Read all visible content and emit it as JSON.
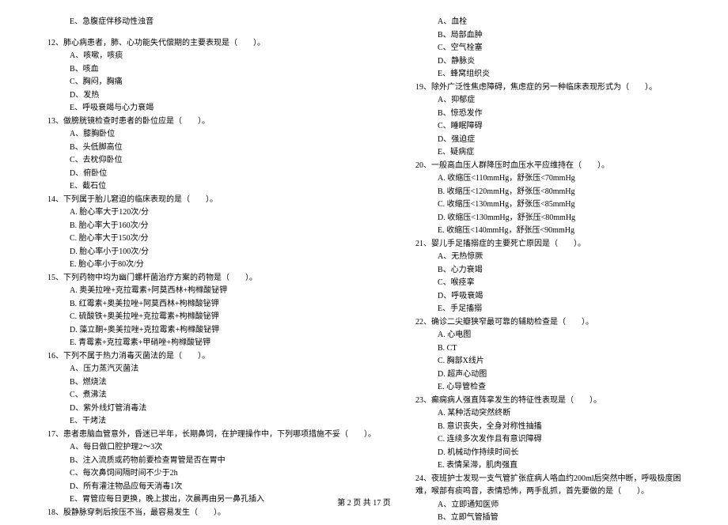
{
  "left": {
    "q11e": "E、急腹症伴移动性浊音",
    "q12": "12、肺心病患者，肺、心功能失代偿期的主要表现是（　　）。",
    "q12a": "A、咳嗽，咳痰",
    "q12b": "B、咳血",
    "q12c": "C、胸闷，胸痛",
    "q12d": "D、发热",
    "q12e": "E、呼吸衰竭与心力衰竭",
    "q13": "13、做膀胱镜检查时患者的卧位应是（　　）。",
    "q13a": "A、膝胸卧位",
    "q13b": "B、头低脚高位",
    "q13c": "C、去枕仰卧位",
    "q13d": "D、俯卧位",
    "q13e": "E、截石位",
    "q14": "14、下列属于胎儿窘迫的临床表现的是（　　）。",
    "q14a": "A. 胎心率大于120次/分",
    "q14b": "B. 胎心率大于160次/分",
    "q14c": "C. 胎心率大于150次/分",
    "q14d": "D. 胎心率小于100次/分",
    "q14e": "E. 胎心率小于80次/分",
    "q15": "15、下列药物中均为幽门螺杆菌治疗方案的药物是（　　）。",
    "q15a": "A. 奥美拉唑+克拉霉素+阿莫西林+枸橼酸铋钾",
    "q15b": "B. 红霉素+奥美拉唑+阿莫西林+枸橼酸铋钾",
    "q15c": "C. 硫酸铁+奥美拉唑+克拉霉素+枸橼酸铋钾",
    "q15d": "D. 藻立酮+奥美拉唑+克拉霉素+枸橼酸铋钾",
    "q15e": "E. 青霉素+克拉霉素+甲硝唑+枸橼酸铋钾",
    "q16": "16、下列不属于热力消毒灭菌法的是（　　）。",
    "q16a": "A、压力蒸汽灭菌法",
    "q16b": "B、燃烧法",
    "q16c": "C、煮沸法",
    "q16d": "D、紫外线灯管消毒法",
    "q16e": "E、干烤法",
    "q17": "17、患者患脑血管意外，昏迷已半年，长期鼻饲，在护理操作中，下列哪项措施不妥（　　）。",
    "q17a": "A、每日做口腔护理2～3次",
    "q17b": "B、注入流质或药物前要检查胃管是否在胃中",
    "q17c": "C、每次鼻饲间隔时间不少于2h",
    "q17d": "D、所有灌注物品应每天消毒1次",
    "q17e": "E、胃管应每日更换，晚上拔出，次晨再由另一鼻孔插入",
    "q18": "18、股静脉穿刺后按压不当，最容易发生（　　）。"
  },
  "right": {
    "q18a": "A、血栓",
    "q18b": "B、局部血肿",
    "q18c": "C、空气栓塞",
    "q18d": "D、静脉炎",
    "q18e": "E、蜂窝组织炎",
    "q19": "19、除外广泛性焦虑障碍，焦虑症的另一种临床表现形式为（　　）。",
    "q19a": "A、抑郁症",
    "q19b": "B、惊恐发作",
    "q19c": "C、睡眠障碍",
    "q19d": "D、强迫症",
    "q19e": "E、疑病症",
    "q20": "20、一般高血压人群降压时血压水平应维持在（　　）。",
    "q20a": "A. 收缩压<110mmHg，舒张压<70mmHg",
    "q20b": "B. 收缩压<120mmHg，舒张压<80mmHg",
    "q20c": "C. 收缩压<130mmHg，舒张压<85mmHg",
    "q20d": "D. 收缩压<130mmHg，舒张压<80mmHg",
    "q20e": "E. 收缩压<140mmHg，舒张压<90mmHg",
    "q21": "21、婴儿手足搐搦症的主要死亡原因是（　　）。",
    "q21a": "A、无热惊厥",
    "q21b": "B、心力衰竭",
    "q21c": "C、喉痉挛",
    "q21d": "D、呼吸衰竭",
    "q21e": "E、手足搐搦",
    "q22": "22、确诊二尖瓣狭窄最可靠的辅助检查是（　　）。",
    "q22a": "A. 心电图",
    "q22b": "B. CT",
    "q22c": "C. 胸部X线片",
    "q22d": "D. 超声心动图",
    "q22e": "E. 心导管检查",
    "q23": "23、癫痫病人强直阵挛发生的特征性表现是（　　）。",
    "q23a": "A. 某种活动突然终断",
    "q23b": "B. 意识丧失，全身对称性抽搐",
    "q23c": "C. 连续多次发作且有意识障碍",
    "q23d": "D. 机械动作持续时间长",
    "q23e": "E. 表情呆滞，肌肉强直",
    "q24": "24、夜班护士发现一支气管扩张症病人咯血约200ml后突然中断，呼吸极度困难，喉部有痰鸣音，表情恐怖，两手乱抓，首先要做的是（　　）。",
    "q24a": "A、立即通知医师",
    "q24b": "B、立即气管插管"
  },
  "footer": "第 2 页 共 17 页"
}
